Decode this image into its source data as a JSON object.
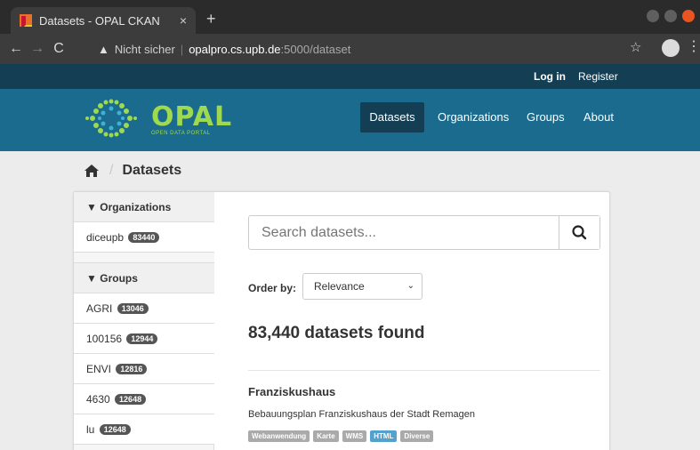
{
  "browser": {
    "tab_title": "Datasets - OPAL CKAN",
    "tab_close": "×",
    "new_tab": "+",
    "security_label": "Nicht sicher",
    "url_host": "opalpro.cs.upb.de",
    "url_path": ":5000/dataset"
  },
  "account": {
    "login": "Log in",
    "register": "Register"
  },
  "logo": {
    "title": "OPAL",
    "subtitle": "OPEN DATA PORTAL"
  },
  "nav": {
    "datasets": "Datasets",
    "organizations": "Organizations",
    "groups": "Groups",
    "about": "About"
  },
  "breadcrumb": {
    "current": "Datasets"
  },
  "sidebar": {
    "organizations_heading": "Organizations",
    "organizations": [
      {
        "label": "diceupb",
        "count": "83440"
      }
    ],
    "groups_heading": "Groups",
    "groups": [
      {
        "label": "AGRI",
        "count": "13046"
      },
      {
        "label": "100156",
        "count": "12944"
      },
      {
        "label": "ENVI",
        "count": "12816"
      },
      {
        "label": "4630",
        "count": "12648"
      },
      {
        "label": "lu",
        "count": "12648"
      }
    ]
  },
  "search": {
    "placeholder": "Search datasets..."
  },
  "order": {
    "label": "Order by:",
    "selected": "Relevance"
  },
  "results": {
    "count_text": "83,440 datasets found",
    "items": [
      {
        "title": "Franziskushaus",
        "description": "Bebauungsplan Franziskushaus der Stadt Remagen",
        "formats": [
          "Webanwendung",
          "Karte",
          "WMS",
          "HTML",
          "Diverse"
        ]
      }
    ]
  },
  "colors": {
    "header_dark": "#133e54",
    "header": "#1a6b8d",
    "logo_green": "#9fd94f",
    "html_badge": "#55a1ce"
  }
}
